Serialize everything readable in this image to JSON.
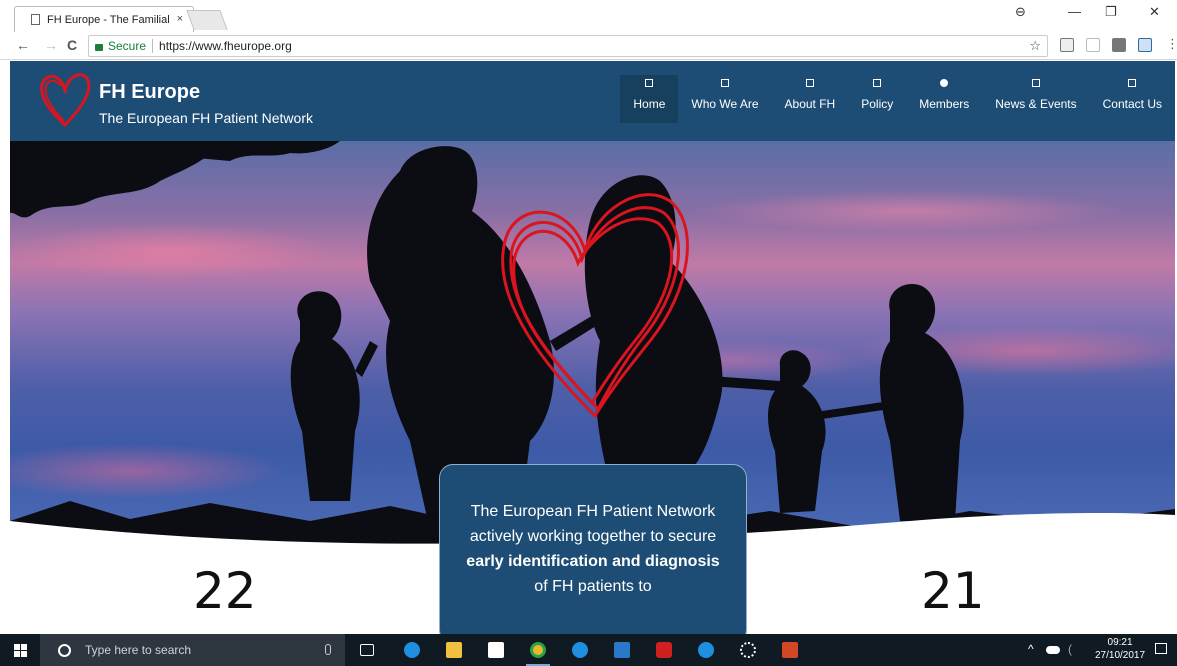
{
  "browser": {
    "tab_title": "FH Europe - The Familial",
    "tab_close": "×",
    "secure_label": "Secure",
    "url": "https://www.fheurope.org",
    "star": "☆",
    "back": "←",
    "forward": "→",
    "reload": "C",
    "menu": "⋮",
    "minimize": "—",
    "restore": "❐",
    "close": "✕",
    "profile": "⊖"
  },
  "site": {
    "brand_title": "FH Europe",
    "brand_subtitle": "The European FH Patient Network",
    "nav": [
      {
        "label": "Home",
        "active": true
      },
      {
        "label": "Who We Are"
      },
      {
        "label": "About FH"
      },
      {
        "label": "Policy"
      },
      {
        "label": "Members"
      },
      {
        "label": "News & Events"
      },
      {
        "label": "Contact Us"
      }
    ],
    "card": {
      "text_1": "The European FH Patient Network actively working together to secure ",
      "bold_1": "early identification and diagnosis",
      "text_2": " of FH patients to"
    },
    "stat_left": "22",
    "stat_right": "21"
  },
  "taskbar": {
    "search_placeholder": "Type here to search",
    "time": "09:21",
    "date": "27/10/2017"
  },
  "colors": {
    "header_bg": "#1d4d75",
    "heart_red": "#d9151f",
    "taskbar_bg": "#101a22"
  }
}
